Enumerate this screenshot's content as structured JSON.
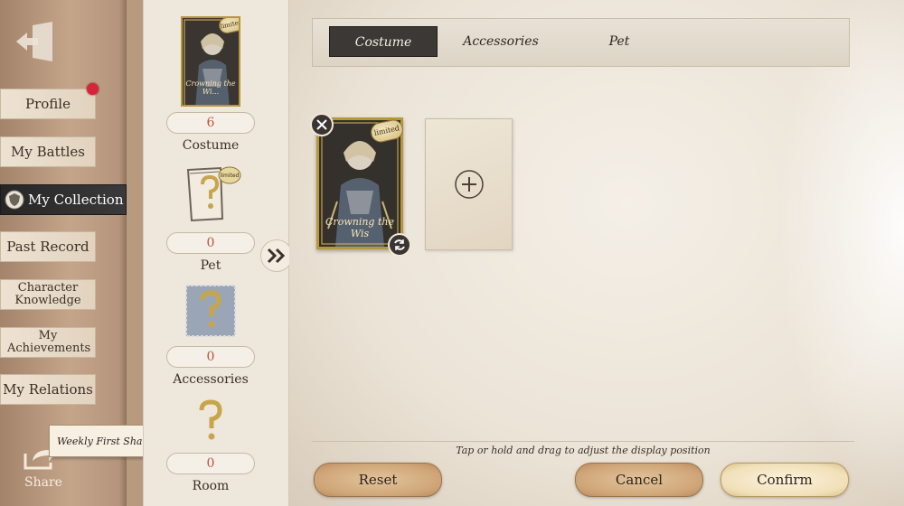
{
  "sidebar": {
    "items": [
      {
        "label": "Profile"
      },
      {
        "label": "My Battles"
      },
      {
        "label": "My Collection"
      },
      {
        "label": "Past Record"
      },
      {
        "label": "Character Knowledge"
      },
      {
        "label": "My Achievements"
      },
      {
        "label": "My Relations"
      }
    ],
    "share_label": "Share",
    "weekly_tip": "Weekly First Share"
  },
  "summary": {
    "card_name": "Crowning the Wi...",
    "limited_badge": "limited",
    "costume": {
      "count": "6",
      "label": "Costume"
    },
    "pet": {
      "count": "0",
      "label": "Pet"
    },
    "accessories": {
      "count": "0",
      "label": "Accessories"
    },
    "room": {
      "count": "0",
      "label": "Room"
    }
  },
  "tabs": [
    {
      "label": "Costume",
      "active": true
    },
    {
      "label": "Accessories",
      "active": false
    },
    {
      "label": "Pet",
      "active": false
    }
  ],
  "selected_card": {
    "name": "Crowning the Wis",
    "badge": "limited"
  },
  "hint": "Tap or hold and drag to adjust the display position",
  "buttons": {
    "reset": "Reset",
    "cancel": "Cancel",
    "confirm": "Confirm"
  },
  "colors": {
    "accent_red": "#d8243a",
    "gold_frame": "#b8963c",
    "count_text": "#c0533a"
  }
}
